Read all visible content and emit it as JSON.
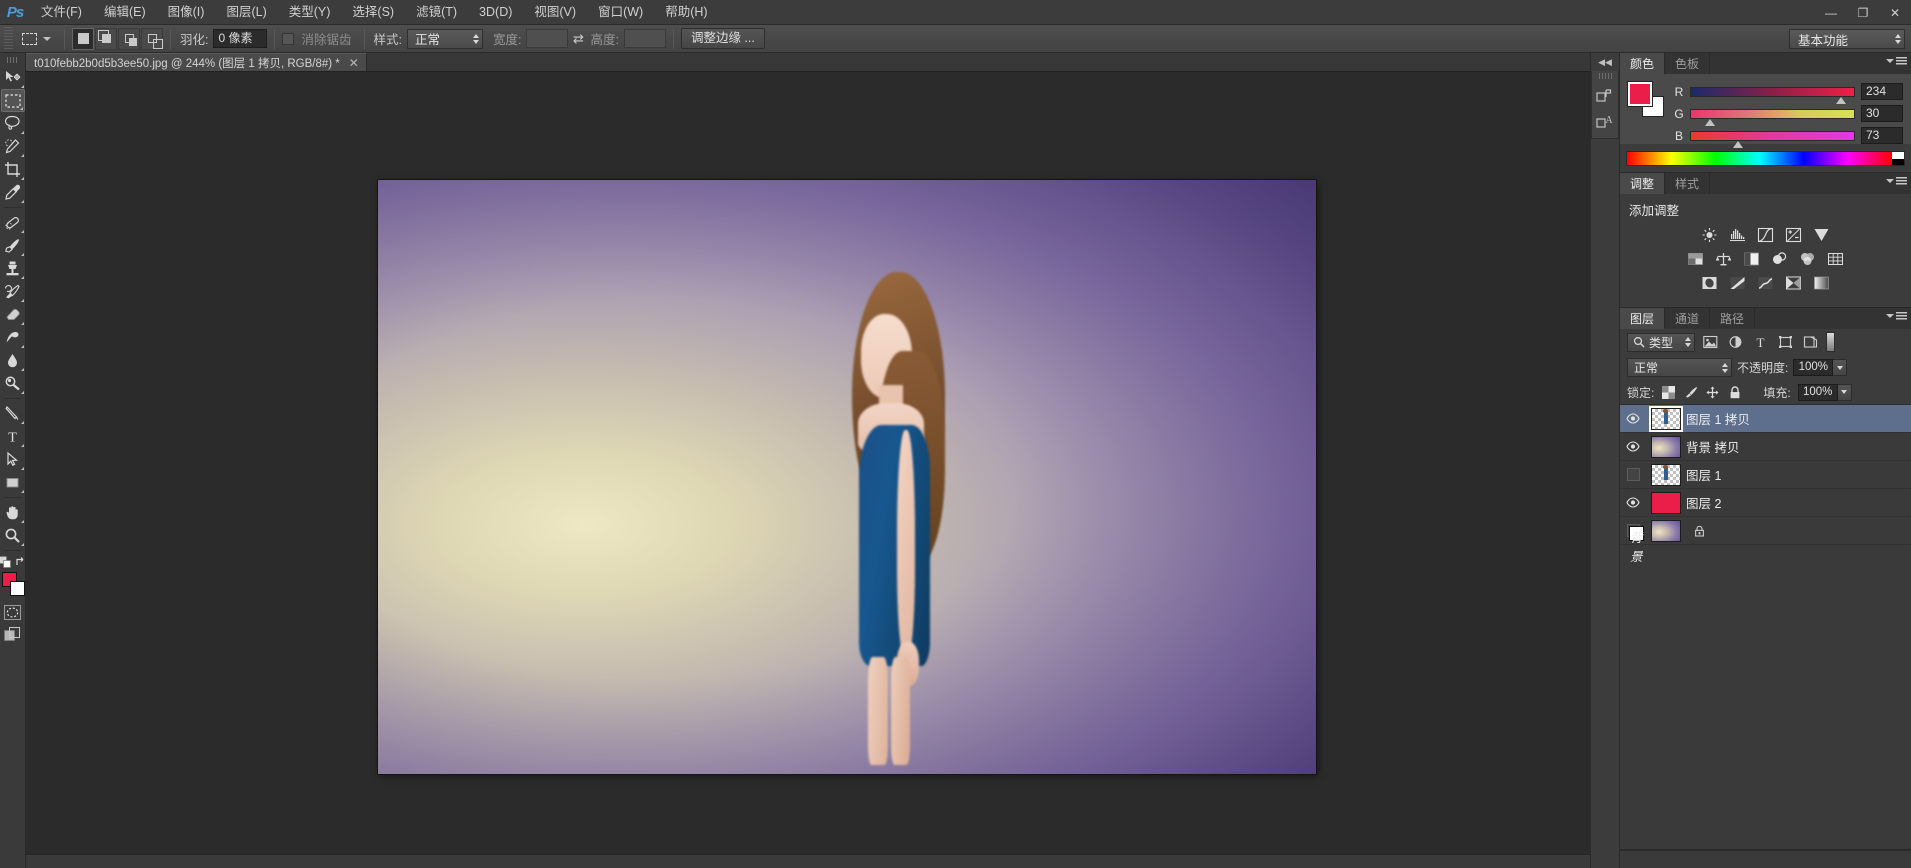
{
  "app": {
    "logo": "Ps",
    "workspace": "基本功能"
  },
  "menubar": {
    "items": [
      {
        "label": "文件(F)",
        "name": "menu-file"
      },
      {
        "label": "编辑(E)",
        "name": "menu-edit"
      },
      {
        "label": "图像(I)",
        "name": "menu-image"
      },
      {
        "label": "图层(L)",
        "name": "menu-layer"
      },
      {
        "label": "类型(Y)",
        "name": "menu-type"
      },
      {
        "label": "选择(S)",
        "name": "menu-select"
      },
      {
        "label": "滤镜(T)",
        "name": "menu-filter"
      },
      {
        "label": "3D(D)",
        "name": "menu-3d"
      },
      {
        "label": "视图(V)",
        "name": "menu-view"
      },
      {
        "label": "窗口(W)",
        "name": "menu-window"
      },
      {
        "label": "帮助(H)",
        "name": "menu-help"
      }
    ]
  },
  "window": {
    "minimize": "—",
    "restore": "❐",
    "close": "✕"
  },
  "options": {
    "tool_icon": "rectangular-marquee-icon",
    "feather_label": "羽化:",
    "feather_value": "0 像素",
    "antialias_label": "消除锯齿",
    "style_label": "样式:",
    "style_value": "正常",
    "width_label": "宽度:",
    "width_value": "",
    "height_label": "高度:",
    "height_value": "",
    "refine_edge": "调整边缘 ...",
    "selection_modes": [
      "新选区",
      "添加到选区",
      "从选区减去",
      "与选区交叉"
    ]
  },
  "document": {
    "tab_title": "t010febb2b0d5b3ee50.jpg @ 244% (图层 1 拷贝, RGB/8#) *",
    "close": "✕",
    "zoom": "244%",
    "filename": "t010febb2b0d5b3ee50.jpg",
    "color_mode": "RGB/8#"
  },
  "toolbar": {
    "tools": [
      {
        "name": "move-tool",
        "label": "移动工具",
        "active": false
      },
      {
        "name": "rectangular-marquee-tool",
        "label": "矩形选框工具",
        "active": true
      },
      {
        "name": "lasso-tool",
        "label": "套索工具",
        "active": false
      },
      {
        "name": "quick-selection-tool",
        "label": "快速选择工具",
        "active": false
      },
      {
        "name": "crop-tool",
        "label": "裁剪工具",
        "active": false
      },
      {
        "name": "eyedropper-tool",
        "label": "吸管工具",
        "active": false
      },
      {
        "name": "spot-healing-brush-tool",
        "label": "污点修复画笔工具",
        "active": false
      },
      {
        "name": "brush-tool",
        "label": "画笔工具",
        "active": false
      },
      {
        "name": "clone-stamp-tool",
        "label": "仿制图章工具",
        "active": false
      },
      {
        "name": "history-brush-tool",
        "label": "历史记录画笔工具",
        "active": false
      },
      {
        "name": "eraser-tool",
        "label": "橡皮擦工具",
        "active": false
      },
      {
        "name": "gradient-tool",
        "label": "渐变工具",
        "active": false
      },
      {
        "name": "blur-tool",
        "label": "模糊工具",
        "active": false
      },
      {
        "name": "dodge-tool",
        "label": "减淡工具",
        "active": false
      },
      {
        "name": "pen-tool",
        "label": "钢笔工具",
        "active": false
      },
      {
        "name": "horizontal-type-tool",
        "label": "横排文字工具",
        "active": false
      },
      {
        "name": "path-selection-tool",
        "label": "路径选择工具",
        "active": false
      },
      {
        "name": "rectangle-tool",
        "label": "矩形工具",
        "active": false
      },
      {
        "name": "hand-tool",
        "label": "抓手工具",
        "active": false
      },
      {
        "name": "zoom-tool",
        "label": "缩放工具",
        "active": false
      }
    ],
    "foreground_color": "#ea1e49",
    "background_color": "#ffffff",
    "quick_mask_label": "以快速蒙版模式编辑",
    "screen_mode_label": "更改屏幕模式"
  },
  "color_panel": {
    "tabs": [
      {
        "label": "颜色",
        "active": true
      },
      {
        "label": "色板",
        "active": false
      }
    ],
    "foreground": "#ea1e49",
    "background": "#ffffff",
    "channels": [
      {
        "label": "R",
        "value": "234",
        "pct": 91.8
      },
      {
        "label": "G",
        "value": "30",
        "pct": 11.8
      },
      {
        "label": "B",
        "value": "73",
        "pct": 28.6
      }
    ]
  },
  "adjustments_panel": {
    "tabs": [
      {
        "label": "调整",
        "active": true
      },
      {
        "label": "样式",
        "active": false
      }
    ],
    "title": "添加调整",
    "rows": [
      [
        "brightness-contrast-icon",
        "levels-icon",
        "curves-icon",
        "exposure-icon",
        "vibrance-icon"
      ],
      [
        "hue-saturation-icon",
        "color-balance-icon",
        "black-white-icon",
        "photo-filter-icon",
        "channel-mixer-icon",
        "color-lookup-icon"
      ],
      [
        "invert-icon",
        "posterize-icon",
        "threshold-icon",
        "selective-color-icon",
        "gradient-map-icon"
      ]
    ]
  },
  "layers_panel": {
    "tabs": [
      {
        "label": "图层",
        "active": true
      },
      {
        "label": "通道",
        "active": false
      },
      {
        "label": "路径",
        "active": false
      }
    ],
    "filter_label": "类型",
    "filter_icons": [
      "pixel-filter-icon",
      "adjustment-filter-icon",
      "type-filter-icon",
      "shape-filter-icon",
      "smart-object-filter-icon"
    ],
    "blend_mode": "正常",
    "opacity_label": "不透明度:",
    "opacity_value": "100%",
    "lock_label": "锁定:",
    "lock_icons": [
      "lock-transparency-icon",
      "lock-image-icon",
      "lock-position-icon",
      "lock-all-icon"
    ],
    "fill_label": "填充:",
    "fill_value": "100%",
    "layers": [
      {
        "name": "图层 1 拷贝",
        "visible": true,
        "selected": true,
        "locked": false,
        "thumb": "transparent-figure",
        "italic": false
      },
      {
        "name": "背景 拷贝",
        "visible": true,
        "selected": false,
        "locked": false,
        "thumb": "gradient",
        "italic": false
      },
      {
        "name": "图层 1",
        "visible": false,
        "selected": false,
        "locked": false,
        "thumb": "transparent-figure",
        "italic": false
      },
      {
        "name": "图层 2",
        "visible": true,
        "selected": false,
        "locked": false,
        "thumb": "solid-red",
        "italic": false
      },
      {
        "name": "背景",
        "visible": false,
        "selected": false,
        "locked": true,
        "thumb": "gradient",
        "italic": true
      }
    ]
  },
  "colors": {
    "accent_red": "#ea1e49",
    "selection_blue": "#5d6f8d",
    "panel_bg": "#3c3c3c",
    "canvas_bg": "#2b2b2b"
  }
}
